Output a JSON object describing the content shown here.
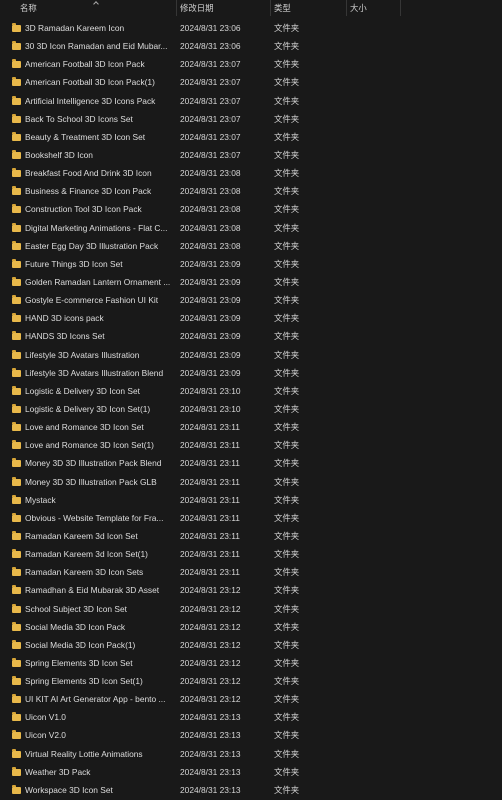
{
  "header": {
    "name": "名称",
    "modified": "修改日期",
    "type": "类型",
    "size": "大小",
    "sort_icon": "chevron-up-icon"
  },
  "colors": {
    "background": "#191919",
    "text": "#dcdcdc",
    "folder": "#e8b84a"
  },
  "files": [
    {
      "name": "3D Ramadan Kareem Icon",
      "modified": "2024/8/31 23:06",
      "type": "文件夹"
    },
    {
      "name": "30 3D Icon Ramadan and Eid Mubar...",
      "modified": "2024/8/31 23:06",
      "type": "文件夹"
    },
    {
      "name": "American Football 3D Icon Pack",
      "modified": "2024/8/31 23:07",
      "type": "文件夹"
    },
    {
      "name": "American Football 3D Icon Pack(1)",
      "modified": "2024/8/31 23:07",
      "type": "文件夹"
    },
    {
      "name": "Artificial Intelligence 3D Icons Pack",
      "modified": "2024/8/31 23:07",
      "type": "文件夹"
    },
    {
      "name": "Back To School 3D Icons Set",
      "modified": "2024/8/31 23:07",
      "type": "文件夹"
    },
    {
      "name": "Beauty & Treatment 3D Icon Set",
      "modified": "2024/8/31 23:07",
      "type": "文件夹"
    },
    {
      "name": "Bookshelf 3D Icon",
      "modified": "2024/8/31 23:07",
      "type": "文件夹"
    },
    {
      "name": "Breakfast Food And Drink 3D Icon",
      "modified": "2024/8/31 23:08",
      "type": "文件夹"
    },
    {
      "name": "Business & Finance 3D Icon Pack",
      "modified": "2024/8/31 23:08",
      "type": "文件夹"
    },
    {
      "name": "Construction Tool 3D Icon Pack",
      "modified": "2024/8/31 23:08",
      "type": "文件夹"
    },
    {
      "name": "Digital Marketing Animations - Flat C...",
      "modified": "2024/8/31 23:08",
      "type": "文件夹"
    },
    {
      "name": "Easter Egg Day 3D Illustration Pack",
      "modified": "2024/8/31 23:08",
      "type": "文件夹"
    },
    {
      "name": "Future Things 3D Icon Set",
      "modified": "2024/8/31 23:09",
      "type": "文件夹"
    },
    {
      "name": "Golden Ramadan Lantern Ornament ...",
      "modified": "2024/8/31 23:09",
      "type": "文件夹"
    },
    {
      "name": "Gostyle E-commerce Fashion UI Kit",
      "modified": "2024/8/31 23:09",
      "type": "文件夹"
    },
    {
      "name": "HAND 3D icons pack",
      "modified": "2024/8/31 23:09",
      "type": "文件夹"
    },
    {
      "name": "HANDS 3D Icons Set",
      "modified": "2024/8/31 23:09",
      "type": "文件夹"
    },
    {
      "name": "Lifestyle 3D Avatars Illustration",
      "modified": "2024/8/31 23:09",
      "type": "文件夹"
    },
    {
      "name": "Lifestyle 3D Avatars Illustration Blend",
      "modified": "2024/8/31 23:09",
      "type": "文件夹"
    },
    {
      "name": "Logistic & Delivery 3D Icon Set",
      "modified": "2024/8/31 23:10",
      "type": "文件夹"
    },
    {
      "name": "Logistic & Delivery 3D Icon Set(1)",
      "modified": "2024/8/31 23:10",
      "type": "文件夹"
    },
    {
      "name": "Love and Romance 3D Icon Set",
      "modified": "2024/8/31 23:11",
      "type": "文件夹"
    },
    {
      "name": "Love and Romance 3D Icon Set(1)",
      "modified": "2024/8/31 23:11",
      "type": "文件夹"
    },
    {
      "name": "Money 3D 3D Illustration Pack Blend",
      "modified": "2024/8/31 23:11",
      "type": "文件夹"
    },
    {
      "name": "Money 3D 3D Illustration Pack GLB",
      "modified": "2024/8/31 23:11",
      "type": "文件夹"
    },
    {
      "name": "Mystack",
      "modified": "2024/8/31 23:11",
      "type": "文件夹"
    },
    {
      "name": "Obvious - Website Template for Fra...",
      "modified": "2024/8/31 23:11",
      "type": "文件夹"
    },
    {
      "name": "Ramadan Kareem 3d Icon Set",
      "modified": "2024/8/31 23:11",
      "type": "文件夹"
    },
    {
      "name": "Ramadan Kareem 3d Icon Set(1)",
      "modified": "2024/8/31 23:11",
      "type": "文件夹"
    },
    {
      "name": "Ramadan Kareem 3D Icon Sets",
      "modified": "2024/8/31 23:11",
      "type": "文件夹"
    },
    {
      "name": "Ramadhan & Eid Mubarak 3D Asset",
      "modified": "2024/8/31 23:12",
      "type": "文件夹"
    },
    {
      "name": "School Subject 3D Icon Set",
      "modified": "2024/8/31 23:12",
      "type": "文件夹"
    },
    {
      "name": "Social Media 3D Icon Pack",
      "modified": "2024/8/31 23:12",
      "type": "文件夹"
    },
    {
      "name": "Social Media 3D Icon Pack(1)",
      "modified": "2024/8/31 23:12",
      "type": "文件夹"
    },
    {
      "name": "Spring Elements 3D Icon Set",
      "modified": "2024/8/31 23:12",
      "type": "文件夹"
    },
    {
      "name": "Spring Elements 3D Icon Set(1)",
      "modified": "2024/8/31 23:12",
      "type": "文件夹"
    },
    {
      "name": "UI KIT AI Art Generator App - bento ...",
      "modified": "2024/8/31 23:12",
      "type": "文件夹"
    },
    {
      "name": "Uicon V1.0",
      "modified": "2024/8/31 23:13",
      "type": "文件夹"
    },
    {
      "name": "Uicon V2.0",
      "modified": "2024/8/31 23:13",
      "type": "文件夹"
    },
    {
      "name": "Virtual Reality Lottie Animations",
      "modified": "2024/8/31 23:13",
      "type": "文件夹"
    },
    {
      "name": "Weather 3D Pack",
      "modified": "2024/8/31 23:13",
      "type": "文件夹"
    },
    {
      "name": "Workspace 3D Icon Set",
      "modified": "2024/8/31 23:13",
      "type": "文件夹"
    }
  ]
}
